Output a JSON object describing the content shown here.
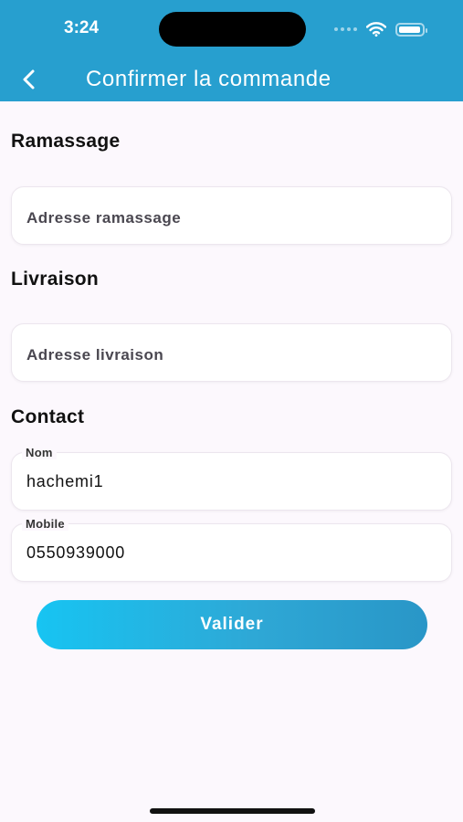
{
  "status_bar": {
    "time": "3:24",
    "battery_fraction": 0.95
  },
  "header": {
    "title": "Confirmer la commande",
    "back_icon": "chevron-left-icon"
  },
  "sections": {
    "pickup": {
      "title": "Ramassage",
      "placeholder": "Adresse ramassage"
    },
    "delivery": {
      "title": "Livraison",
      "placeholder": "Adresse livraison"
    },
    "contact": {
      "title": "Contact",
      "name_label": "Nom",
      "name_value": "hachemi1",
      "mobile_label": "Mobile",
      "mobile_value": "0550939000"
    }
  },
  "actions": {
    "submit_label": "Valider"
  },
  "colors": {
    "header_bg": "#279fcf",
    "background": "#fcf8fd",
    "button_gradient_start": "#17c4f2",
    "button_gradient_end": "#2996c7"
  }
}
